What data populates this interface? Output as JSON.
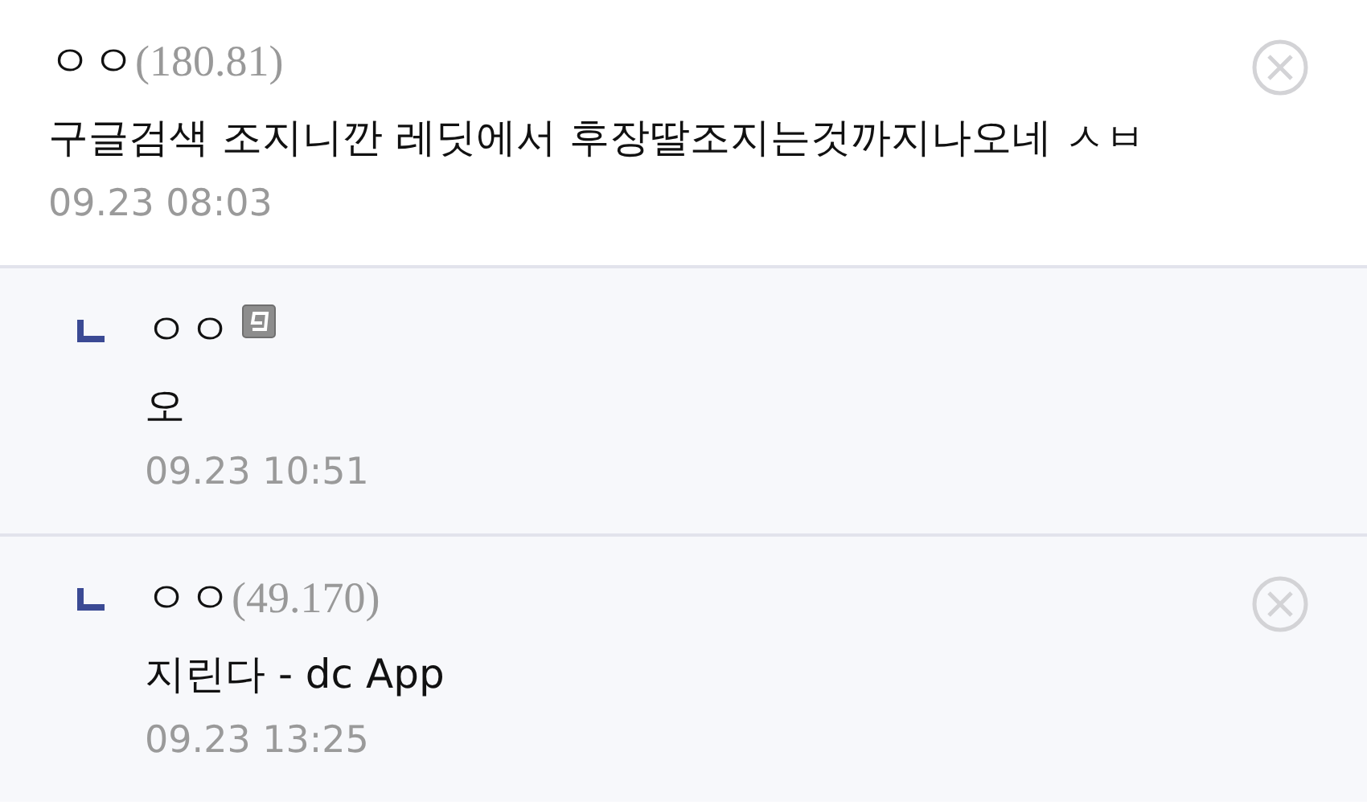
{
  "comments": [
    {
      "kind": "comment",
      "nickname": "ㅇㅇ",
      "ip": "(180.81)",
      "member": false,
      "text": "구글검색 조지니깐 레딧에서 후장딸조지는것까지나오네 ㅅㅂ",
      "time": "09.23 08:03",
      "deletable": true
    },
    {
      "kind": "reply",
      "nickname": "ㅇㅇ",
      "member": true,
      "text": "오",
      "time": "09.23 10:51",
      "deletable": false
    },
    {
      "kind": "reply",
      "nickname": "ㅇㅇ",
      "ip": "(49.170)",
      "member": false,
      "text": "지린다 - dc App",
      "time": "09.23 13:25",
      "deletable": true
    }
  ]
}
